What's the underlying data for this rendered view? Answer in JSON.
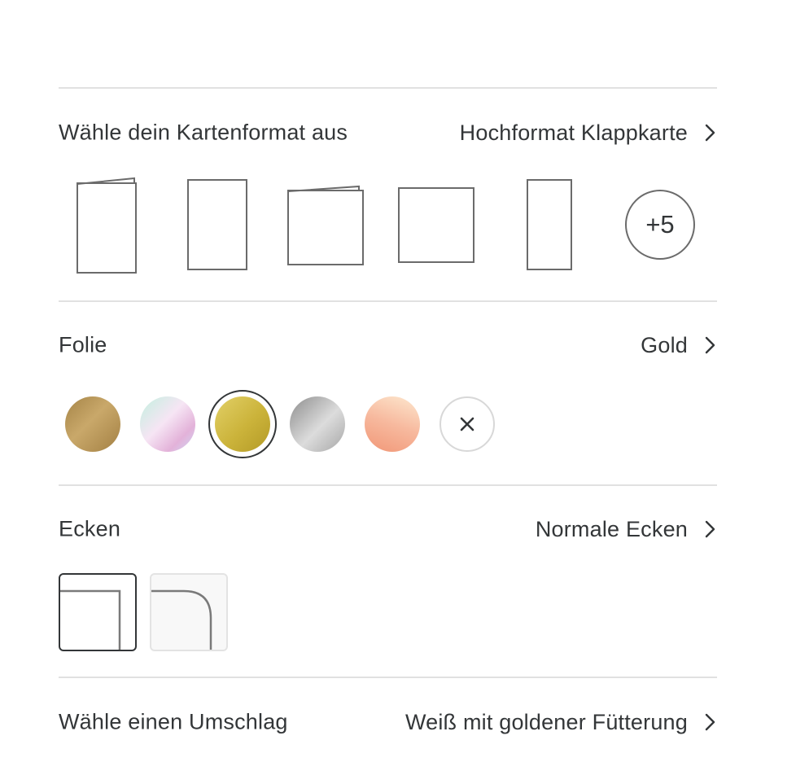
{
  "format": {
    "label": "Wähle dein Kartenformat aus",
    "value": "Hochformat Klappkarte",
    "more_label": "+5"
  },
  "foil": {
    "label": "Folie",
    "value": "Gold",
    "options": [
      "bronze",
      "holographic",
      "gold",
      "silver",
      "rose-gold",
      "none"
    ],
    "selected": "gold"
  },
  "corners": {
    "label": "Ecken",
    "value": "Normale Ecken",
    "options": [
      "normal",
      "rounded"
    ],
    "selected": "normal"
  },
  "envelope": {
    "label": "Wähle einen Umschlag",
    "value": "Weiß mit goldener Fütterung"
  },
  "colors": {
    "text": "#333638",
    "divider": "#e1e1e1",
    "outline": "#6b6b6b"
  }
}
